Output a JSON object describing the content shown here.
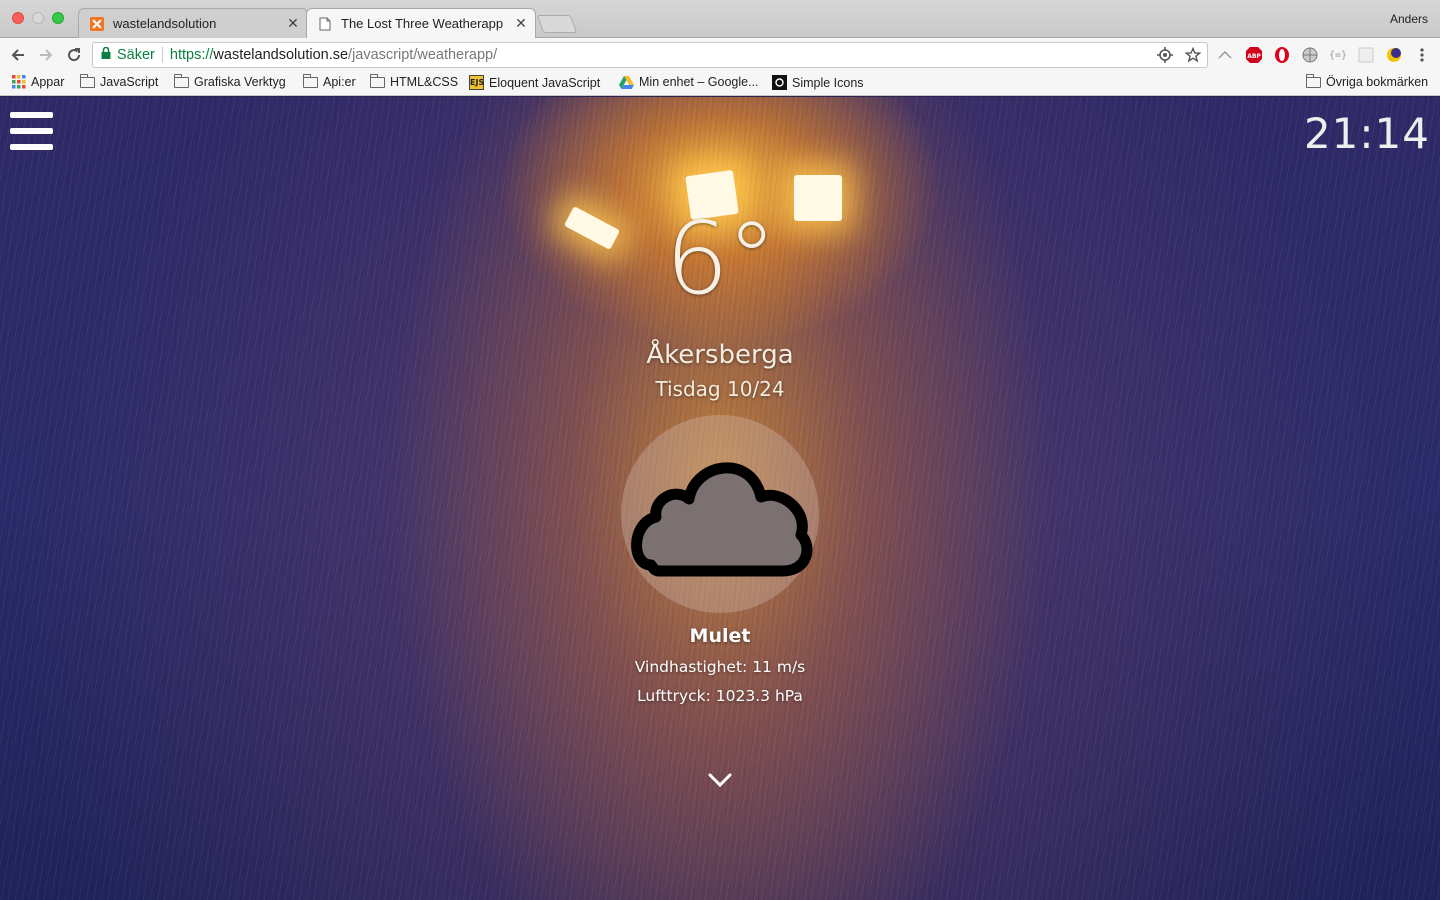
{
  "browser": {
    "tabs": [
      {
        "label": "wastelandsolution",
        "icon": "xampp-favicon-icon"
      },
      {
        "label": "The Lost Three Weatherapp",
        "icon": "page-favicon-icon"
      }
    ],
    "profile": "Anders",
    "address": {
      "secure_label": "Säker",
      "scheme": "https://",
      "host": "wastelandsolution.se",
      "path": "/javascript/weatherapp/"
    },
    "bookmarks": [
      {
        "label": "Appar",
        "icon": "apps-grid-icon"
      },
      {
        "label": "JavaScript",
        "icon": "folder-icon"
      },
      {
        "label": "Grafiska Verktyg",
        "icon": "folder-icon"
      },
      {
        "label": "Api:er",
        "icon": "folder-icon"
      },
      {
        "label": "HTML&CSS",
        "icon": "folder-icon"
      },
      {
        "label": "Eloquent JavaScript",
        "icon": "ejs-icon"
      },
      {
        "label": "Min enhet – Google...",
        "icon": "google-drive-icon"
      },
      {
        "label": "Simple Icons",
        "icon": "simple-icons-icon"
      }
    ],
    "other_bookmarks": "Övriga bokmärken"
  },
  "weather": {
    "clock": "21:14",
    "temperature": "6°",
    "city": "Åkersberga",
    "date": "Tisdag 10/24",
    "condition_icon": "cloud-icon",
    "condition": "Mulet",
    "wind": "Vindhastighet: 11 m/s",
    "pressure": "Lufttryck: 1023.3 hPa"
  },
  "colors": {
    "cloud_fill": "#7b7170",
    "cloud_stroke": "#000000",
    "secure_green": "#0b8043"
  }
}
